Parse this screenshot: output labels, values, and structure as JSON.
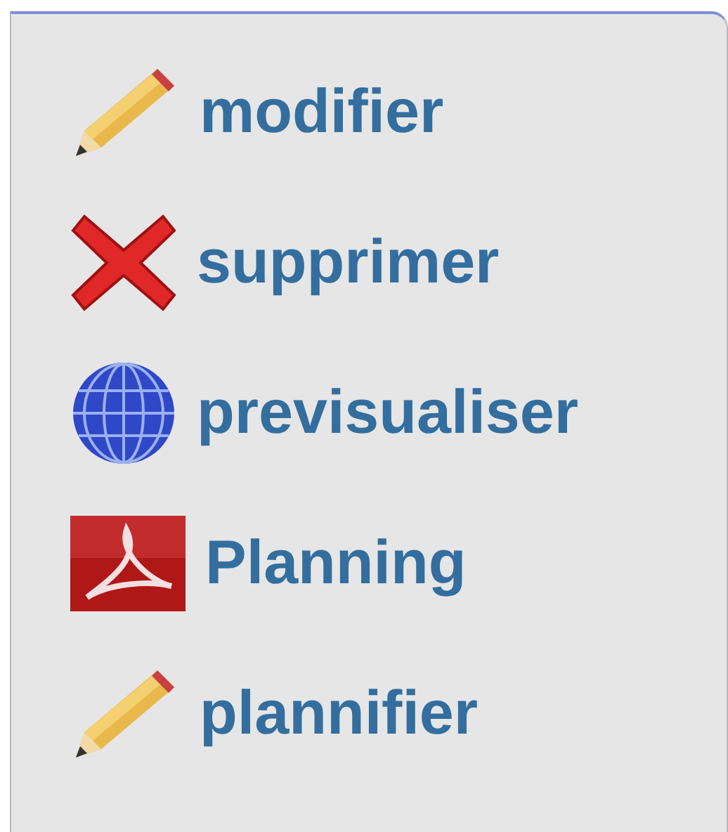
{
  "menu": {
    "items": [
      {
        "kind": "pencil",
        "label": "modifier"
      },
      {
        "kind": "delete",
        "label": "supprimer"
      },
      {
        "kind": "globe",
        "label": "previsualiser"
      },
      {
        "kind": "pdf",
        "label": "Planning"
      },
      {
        "kind": "pencil",
        "label": "plannifier"
      }
    ]
  }
}
